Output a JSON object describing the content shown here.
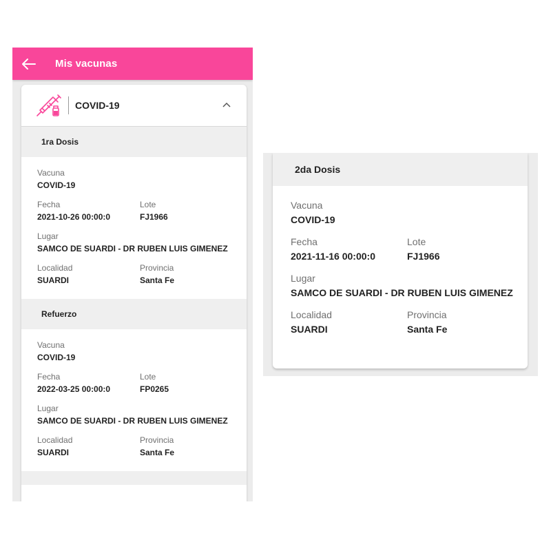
{
  "app_bar": {
    "title": "Mis vacunas",
    "back_icon": "arrow-left-icon",
    "color": "#f9469a"
  },
  "vaccine": {
    "title": "COVID-19",
    "icon": "syringe-icon",
    "expand_icon": "chevron-up-icon"
  },
  "doses": [
    {
      "title": "1ra Dosis",
      "vacuna_label": "Vacuna",
      "vacuna": "COVID-19",
      "fecha_label": "Fecha",
      "fecha": "2021-10-26 00:00:0",
      "lote_label": "Lote",
      "lote": "FJ1966",
      "lugar_label": "Lugar",
      "lugar": "SAMCO DE  SUARDI - DR RUBEN LUIS GIMENEZ",
      "localidad_label": "Localidad",
      "localidad": "SUARDI",
      "provincia_label": "Provincia",
      "provincia": "Santa Fe"
    },
    {
      "title": "Refuerzo",
      "vacuna_label": "Vacuna",
      "vacuna": "COVID-19",
      "fecha_label": "Fecha",
      "fecha": "2022-03-25 00:00:0",
      "lote_label": "Lote",
      "lote": "FP0265",
      "lugar_label": "Lugar",
      "lugar": "SAMCO DE  SUARDI - DR RUBEN LUIS GIMENEZ",
      "localidad_label": "Localidad",
      "localidad": "SUARDI",
      "provincia_label": "Provincia",
      "provincia": "Santa Fe"
    },
    {
      "title": "2da Dosis",
      "vacuna_label": "Vacuna",
      "vacuna": "COVID-19",
      "fecha_label": "Fecha",
      "fecha": "2021-11-16 00:00:0",
      "lote_label": "Lote",
      "lote": "FJ1966",
      "lugar_label": "Lugar",
      "lugar": "SAMCO DE  SUARDI - DR RUBEN LUIS GIMENEZ",
      "localidad_label": "Localidad",
      "localidad": "SUARDI",
      "provincia_label": "Provincia",
      "provincia": "Santa Fe"
    }
  ]
}
